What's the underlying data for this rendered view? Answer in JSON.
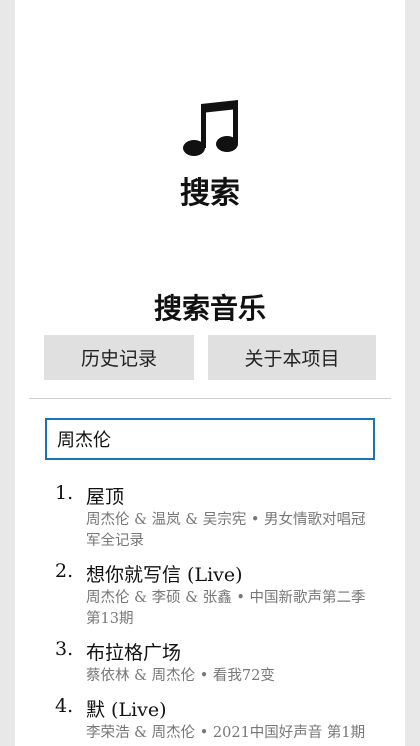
{
  "header": {
    "icon": "music-note-icon",
    "title": "搜索"
  },
  "page": {
    "section_title": "搜索音乐",
    "history_button": "历史记录",
    "about_button": "关于本项目"
  },
  "search": {
    "value": "周杰伦"
  },
  "results": [
    {
      "index": "1.",
      "title": "屋顶",
      "meta": "周杰伦 & 温岚 & 吴宗宪 • 男女情歌对唱冠军全记录"
    },
    {
      "index": "2.",
      "title": "想你就写信 (Live)",
      "meta": "周杰伦 & 李硕 & 张鑫 • 中国新歌声第二季 第13期"
    },
    {
      "index": "3.",
      "title": "布拉格广场",
      "meta": "蔡依林 & 周杰伦 • 看我72变"
    },
    {
      "index": "4.",
      "title": "默 (Live)",
      "meta": "李荣浩 & 周杰伦 • 2021中国好声音 第1期"
    }
  ]
}
